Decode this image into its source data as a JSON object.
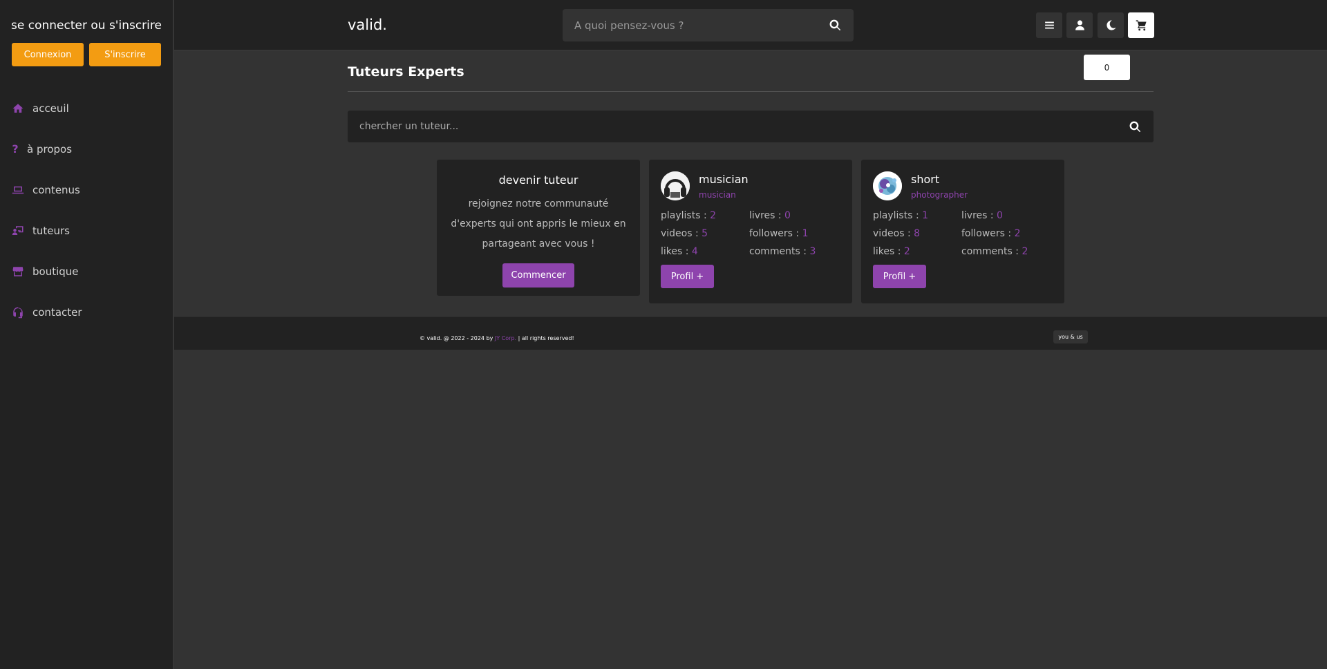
{
  "sidebar": {
    "title": "se connecter ou s'inscrire",
    "login_label": "Connexion",
    "register_label": "S'inscrire",
    "items": [
      {
        "label": "acceuil",
        "icon": "home-icon"
      },
      {
        "label": "à propos",
        "icon": "question-icon"
      },
      {
        "label": "contenus",
        "icon": "laptop-icon"
      },
      {
        "label": "tuteurs",
        "icon": "teacher-icon"
      },
      {
        "label": "boutique",
        "icon": "store-icon"
      },
      {
        "label": "contacter",
        "icon": "headset-icon"
      }
    ]
  },
  "header": {
    "logo": "valid.",
    "search_placeholder": "A quoi pensez-vous ?",
    "cart_count": "0"
  },
  "main": {
    "title": "Tuteurs Experts",
    "search_placeholder": "chercher un tuteur...",
    "become": {
      "title": "devenir tuteur",
      "description": "rejoignez notre communauté d'experts qui ont appris le mieux en partageant avec vous !",
      "button": "Commencer"
    },
    "tutors": [
      {
        "name": "musician",
        "role": "musician",
        "playlists_label": "playlists :",
        "playlists": "2",
        "livres_label": "livres :",
        "livres": "0",
        "videos_label": "videos :",
        "videos": "5",
        "followers_label": "followers :",
        "followers": "1",
        "likes_label": "likes :",
        "likes": "4",
        "comments_label": "comments :",
        "comments": "3",
        "button": "Profil +"
      },
      {
        "name": "short",
        "role": "photographer",
        "playlists_label": "playlists :",
        "playlists": "1",
        "livres_label": "livres :",
        "livres": "0",
        "videos_label": "videos :",
        "videos": "8",
        "followers_label": "followers :",
        "followers": "2",
        "likes_label": "likes :",
        "likes": "2",
        "comments_label": "comments :",
        "comments": "2",
        "button": "Profil +"
      }
    ]
  },
  "footer": {
    "copyright_prefix": "© valid. @ 2022 -  2024 by ",
    "copyright_corp": "JY Corp.",
    "copyright_suffix": " | all rights reserved!",
    "you_us": "you & us"
  },
  "colors": {
    "accent": "#8e44ad",
    "orange": "#f39c12",
    "background": "#333333",
    "panel": "#222222"
  }
}
